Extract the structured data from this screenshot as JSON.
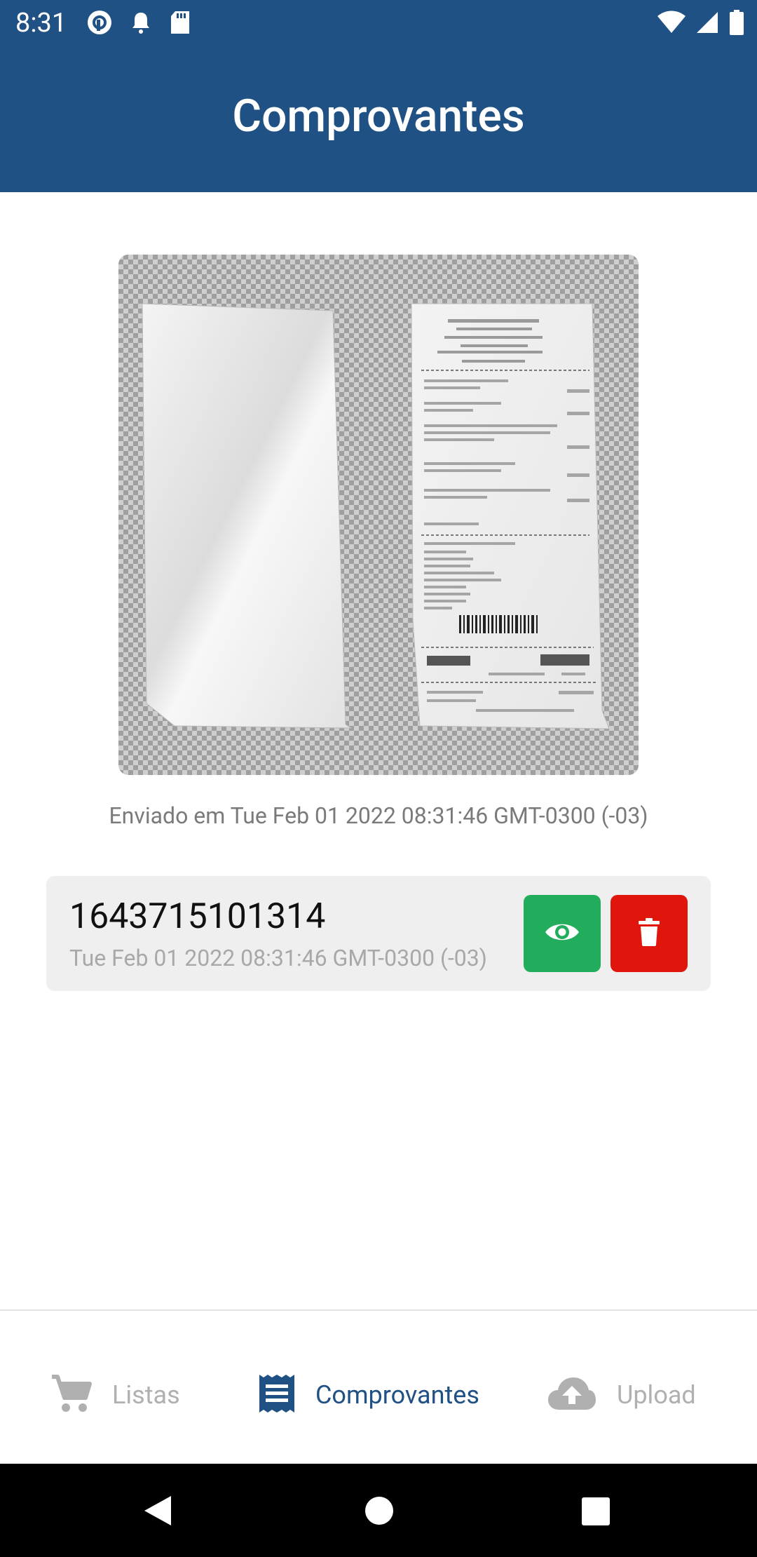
{
  "status_bar": {
    "time": "8:31",
    "left_icons": [
      "pocket-casts-icon",
      "notification-bell-icon",
      "sd-card-icon"
    ],
    "right_icons": [
      "wifi-icon",
      "cell-signal-icon",
      "battery-icon"
    ]
  },
  "app_bar": {
    "title": "Comprovantes"
  },
  "receipt_preview": {
    "icon": "receipt-image"
  },
  "sent_date": "Enviado em Tue Feb 01 2022 08:31:46 GMT-0300 (-03)",
  "receipts": [
    {
      "id": "1643715101314",
      "date": "Tue Feb 01 2022 08:31:46 GMT-0300 (-03)",
      "actions": [
        {
          "icon": "eye-icon",
          "color": "#21ad5b"
        },
        {
          "icon": "trash-icon",
          "color": "#e0160d"
        }
      ]
    }
  ],
  "bottom_nav": {
    "items": [
      {
        "label": "Listas",
        "icon": "cart-icon",
        "active": false
      },
      {
        "label": "Comprovantes",
        "icon": "receipt-list-icon",
        "active": true
      },
      {
        "label": "Upload",
        "icon": "cloud-upload-icon",
        "active": false
      }
    ]
  },
  "system_nav": [
    "back-icon",
    "home-icon",
    "recents-icon"
  ],
  "colors": {
    "primary": "#205184",
    "inactive": "#b0b0b0",
    "view_button": "#21ad5b",
    "delete_button": "#e0160d"
  }
}
